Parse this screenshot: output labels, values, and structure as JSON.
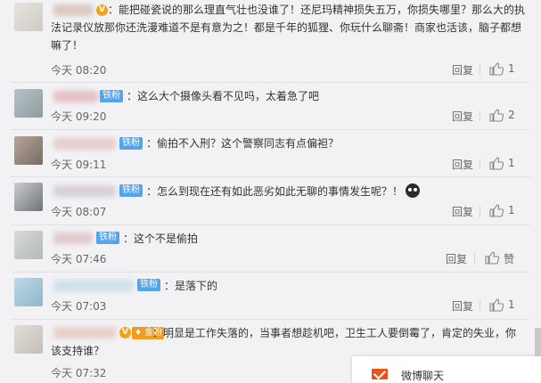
{
  "comments": [
    {
      "text": "：能把碰瓷说的那么理直气壮也没谁了！还尼玛精神损失五万，你损失哪里？那么大的执法记录仪放那你还洗漫难道不是有意为之！都是千年的狐狸、你玩什么聊斋！商家也活该，脑子都想嘛了！",
      "time": "今天 08:20",
      "reply": "回复",
      "likes": "1",
      "badge": "vip"
    },
    {
      "text": "：这么大个摄像头看不见吗，太着急了吧",
      "time": "今天 09:20",
      "reply": "回复",
      "likes": "2",
      "badge": "铁粉"
    },
    {
      "text": "：偷拍不入刑？这个警察同志有点偏袒？",
      "time": "今天 09:11",
      "reply": "回复",
      "likes": "1",
      "badge": "铁粉"
    },
    {
      "text": "：怎么到现在还有如此恶劣如此无聊的事情发生呢？！",
      "time": "今天 08:07",
      "reply": "回复",
      "likes": "1",
      "badge": "铁粉"
    },
    {
      "text": "：这个不是偷拍",
      "time": "今天 07:46",
      "reply": "回复",
      "likes": "赞",
      "badge": "铁粉"
    },
    {
      "text": "：是落下的",
      "time": "今天 07:03",
      "reply": "回复",
      "likes": "1",
      "badge": "铁粉"
    },
    {
      "text": "：明显是工作失落的，当事者想趁机吧，卫生工人要倒霉了，肯定的失业，你该支持谁？",
      "time": "今天 07:32",
      "reply": "回复",
      "likes": "",
      "badge": "金粉"
    }
  ],
  "popup": {
    "label": "微博聊天"
  },
  "colors": {
    "link": "#eb7350",
    "badge_tie": "#56a3e9",
    "badge_gold": "#f39b1c"
  }
}
